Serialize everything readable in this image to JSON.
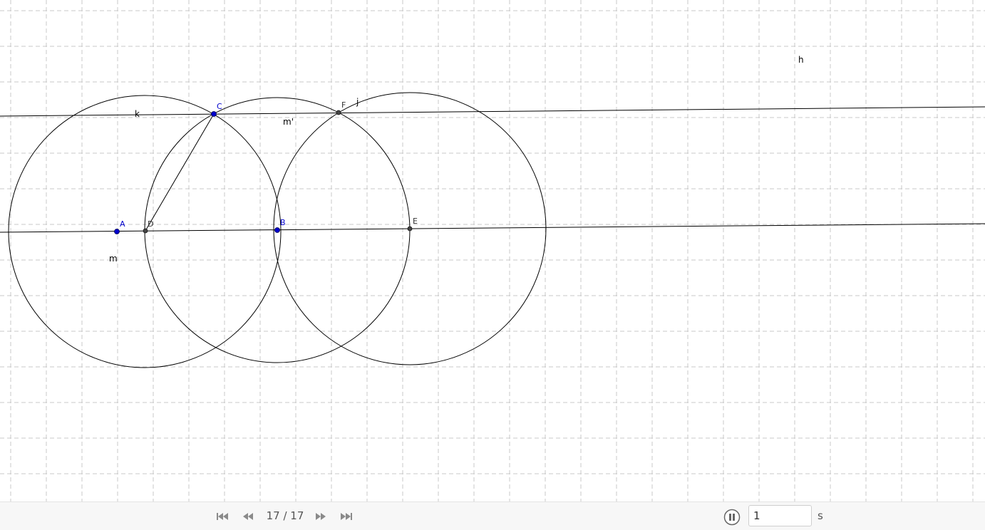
{
  "construction": {
    "points": [
      {
        "id": "A",
        "label": "A",
        "kind": "free"
      },
      {
        "id": "D",
        "label": "D",
        "kind": "dependent"
      },
      {
        "id": "C",
        "label": "C",
        "kind": "free"
      },
      {
        "id": "B",
        "label": "B",
        "kind": "free"
      },
      {
        "id": "F",
        "label": "F",
        "kind": "dependent"
      },
      {
        "id": "E",
        "label": "E",
        "kind": "dependent"
      }
    ],
    "object_labels": [
      "k",
      "m'",
      "j",
      "m",
      "h"
    ],
    "colors": {
      "free_point": "#0000cc",
      "dependent_point": "#333333",
      "grid": "#c8c8c8",
      "line": "#000000"
    }
  },
  "player": {
    "current_step": "17",
    "total_steps": "17",
    "step_text": "17 / 17",
    "interval_value": "1",
    "interval_unit": "s",
    "buttons": {
      "first": "skip-to-start-icon",
      "prev": "rewind-icon",
      "next": "fast-forward-icon",
      "last": "skip-to-end-icon",
      "pause": "pause-icon"
    }
  }
}
